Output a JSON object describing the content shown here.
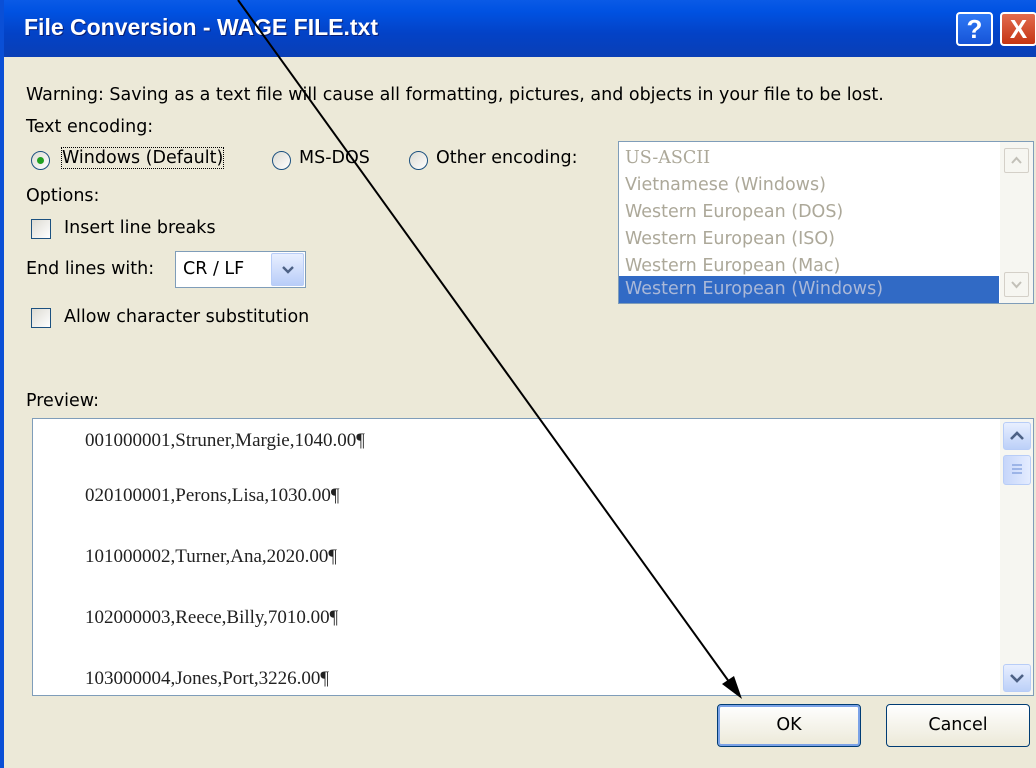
{
  "window": {
    "title": "File Conversion - WAGE FILE.txt",
    "help_label": "?",
    "close_label": "X"
  },
  "warning": "Warning: Saving as a text file will cause all formatting, pictures, and objects in your file to be lost.",
  "encoding": {
    "label": "Text encoding:",
    "options": [
      {
        "label": "Windows (Default)",
        "selected": true
      },
      {
        "label": "MS-DOS",
        "selected": false
      },
      {
        "label": "Other encoding:",
        "selected": false
      }
    ],
    "list": [
      "US-ASCII",
      "Vietnamese (Windows)",
      "Western European (DOS)",
      "Western European (ISO)",
      "Western European (Mac)",
      "Western European (Windows)"
    ],
    "list_selected": "Western European (Windows)"
  },
  "options": {
    "label": "Options:",
    "insert_line_breaks": "Insert line breaks",
    "insert_line_breaks_checked": false,
    "end_lines_label": "End lines with:",
    "end_lines_value": "CR / LF",
    "allow_substitution": "Allow character substitution",
    "allow_substitution_checked": false
  },
  "preview": {
    "label": "Preview:",
    "lines": [
      "001000001,Struner,Margie,1040.00¶",
      "020100001,Perons,Lisa,1030.00¶",
      "101000002,Turner,Ana,2020.00¶",
      "102000003,Reece,Billy,7010.00¶",
      "103000004,Jones,Port,3226.00¶"
    ]
  },
  "buttons": {
    "ok": "OK",
    "cancel": "Cancel"
  },
  "colors": {
    "titlebar": "#0342c6",
    "dialog_bg": "#ece9d8",
    "selection": "#316ac5"
  }
}
